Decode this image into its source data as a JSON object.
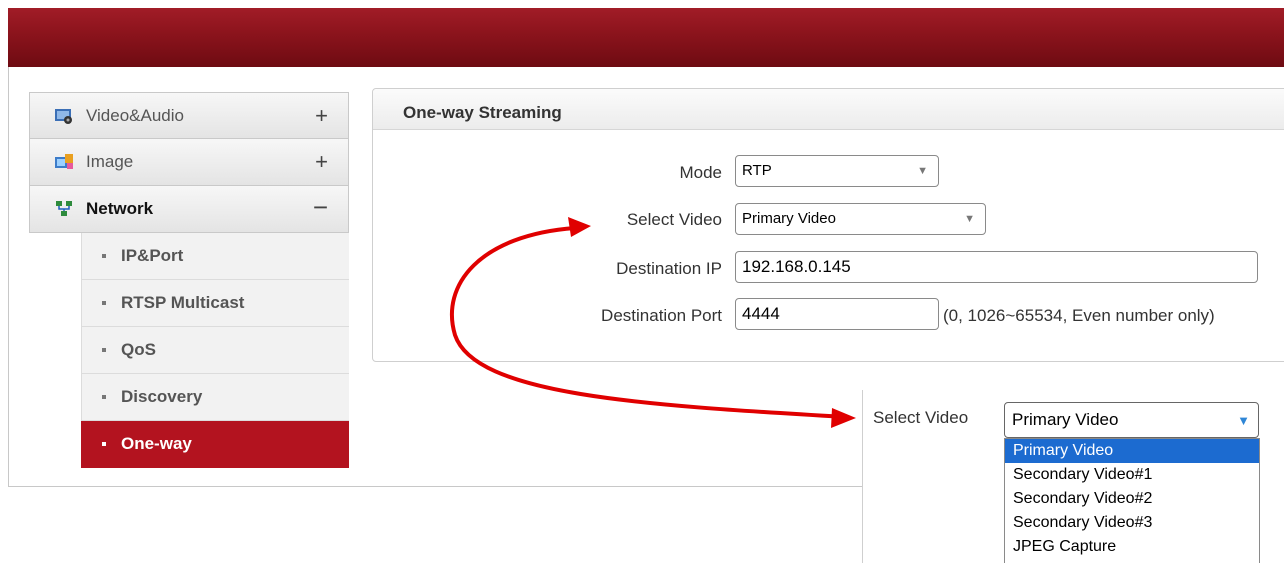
{
  "sidebar": {
    "menus": [
      {
        "label": "Video&Audio",
        "toggle": "+",
        "icon": "video-audio-icon"
      },
      {
        "label": "Image",
        "toggle": "+",
        "icon": "image-icon"
      },
      {
        "label": "Network",
        "toggle": "−",
        "icon": "network-icon"
      }
    ],
    "subitems": [
      {
        "label": "IP&Port"
      },
      {
        "label": "RTSP Multicast"
      },
      {
        "label": "QoS"
      },
      {
        "label": "Discovery"
      },
      {
        "label": "One-way",
        "active": true
      }
    ]
  },
  "panel": {
    "title": "One-way Streaming",
    "mode": {
      "label": "Mode",
      "value": "RTP"
    },
    "select_video": {
      "label": "Select Video",
      "value": "Primary Video"
    },
    "destination_ip": {
      "label": "Destination IP",
      "value": "192.168.0.145"
    },
    "destination_port": {
      "label": "Destination Port",
      "value": "4444",
      "hint": "(0, 1026~65534, Even number only)"
    }
  },
  "callout": {
    "label": "Select Video",
    "value": "Primary Video",
    "options": [
      "Primary Video",
      "Secondary Video#1",
      "Secondary Video#2",
      "Secondary Video#3",
      "JPEG Capture"
    ],
    "selected_index": 0
  },
  "colors": {
    "topbar": "#8d141d",
    "active": "#b3131f",
    "arrow": "#e00000",
    "option_selected": "#1c6bd0"
  }
}
